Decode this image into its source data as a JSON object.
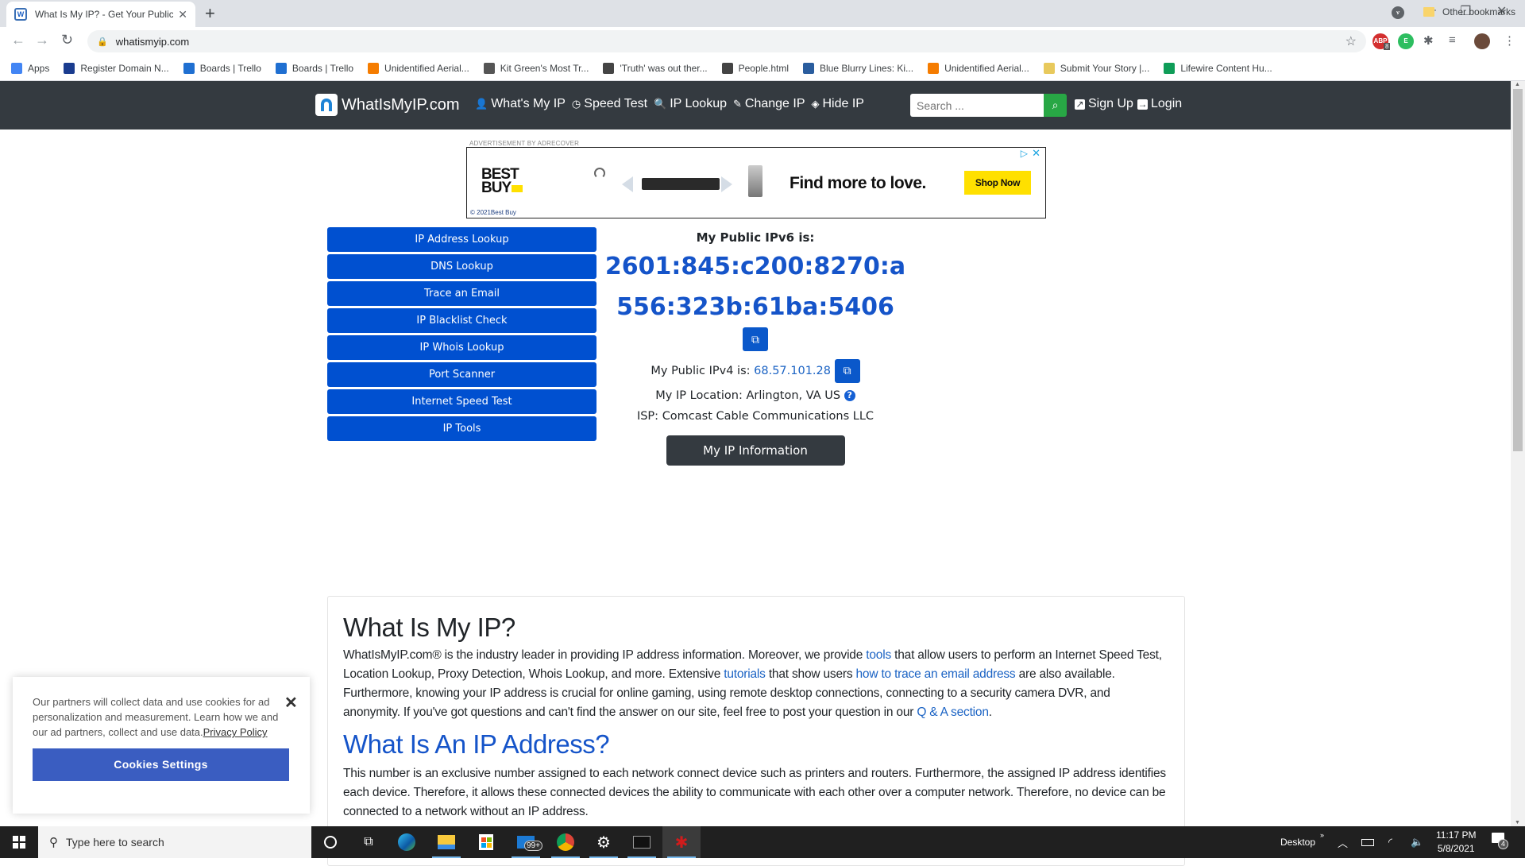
{
  "browser": {
    "tab_title": "What Is My IP? - Get Your Public",
    "url": "whatismyip.com",
    "bookmarks": [
      {
        "label": "Apps",
        "color": "#4285f4"
      },
      {
        "label": "Register Domain N...",
        "color": "#1a3c8f"
      },
      {
        "label": "Boards | Trello",
        "color": "#1f6fd1"
      },
      {
        "label": "Boards | Trello",
        "color": "#1f6fd1"
      },
      {
        "label": "Unidentified Aerial...",
        "color": "#f57c00"
      },
      {
        "label": "Kit Green's Most Tr...",
        "color": "#555555"
      },
      {
        "label": "'Truth' was out ther...",
        "color": "#444444"
      },
      {
        "label": "People.html",
        "color": "#444444"
      },
      {
        "label": "Blue Blurry Lines: Ki...",
        "color": "#2a5d9e"
      },
      {
        "label": "Unidentified Aerial...",
        "color": "#f57c00"
      },
      {
        "label": "Submit Your Story |...",
        "color": "#e8c95c"
      },
      {
        "label": "Lifewire Content Hu...",
        "color": "#0f9d58"
      }
    ],
    "bookmarks_overflow": "»",
    "other_bookmarks": "Other bookmarks",
    "extension_badge": "8"
  },
  "site": {
    "logo_text": "WhatIsMyIP.com",
    "nav": [
      {
        "icon": "user-icon",
        "glyph": "👤",
        "label": "What's My IP"
      },
      {
        "icon": "clock-icon",
        "glyph": "◷",
        "label": "Speed Test"
      },
      {
        "icon": "search-icon",
        "glyph": "🔍",
        "label": "IP Lookup"
      },
      {
        "icon": "edit-icon",
        "glyph": "✎",
        "label": "Change IP"
      },
      {
        "icon": "eye-slash-icon",
        "glyph": "◈",
        "label": "Hide IP"
      }
    ],
    "search_placeholder": "Search ...",
    "signup_label": "Sign Up",
    "login_label": "Login"
  },
  "ad": {
    "label": "ADVERTISEMENT BY ADRECOVER",
    "brand_line1": "BEST",
    "brand_line2": "BUY",
    "tagline": "Find more to love.",
    "cta": "Shop Now",
    "copyright": "© 2021Best Buy"
  },
  "tools": [
    "IP Address Lookup",
    "DNS Lookup",
    "Trace an Email",
    "IP Blacklist Check",
    "IP Whois Lookup",
    "Port Scanner",
    "Internet Speed Test",
    "IP Tools"
  ],
  "ipinfo": {
    "ipv6_label": "My Public IPv6 is:",
    "ipv6_line1": "2601:845:c200:8270:a",
    "ipv6_line2": "556:323b:61ba:5406",
    "ipv4_label": "My Public IPv4 is:",
    "ipv4": "68.57.101.28",
    "location_label": "My IP Location:",
    "location": "Arlington, VA US",
    "isp_label": "ISP:",
    "isp": "Comcast Cable Communications LLC",
    "info_button": "My IP Information"
  },
  "content": {
    "h1": "What Is My IP?",
    "p1": {
      "a": "WhatIsMyIP.com® is the industry leader in providing IP address information. Moreover, we provide ",
      "link1": "tools",
      "b": " that allow users to perform an Internet Speed Test, Location Lookup, Proxy Detection, Whois Lookup, and more. Extensive ",
      "link2": "tutorials",
      "c": " that show users ",
      "link3": "how to trace an email address",
      "d": " are also available. Furthermore, knowing your IP address is crucial for online gaming, using remote desktop connections, connecting to a security camera DVR, and anonymity. If you've got questions and can't find the answer on our site, feel free to post your question in our ",
      "link4": "Q & A section",
      "e": "."
    },
    "h2": "What Is An IP Address?",
    "p2": "This number is an exclusive number assigned to each network connect device such as printers and routers. Furthermore, the assigned IP address identifies each device. Therefore, it allows these connected devices the ability to communicate with each other over a computer network. Therefore, no device can be connected to a network without an IP address."
  },
  "cookie": {
    "message": "Our partners will collect data and use cookies for ad personalization and measurement. Learn how we and our ad partners, collect and use data.",
    "policy_link": "Privacy Policy",
    "settings_button": "Cookies Settings"
  },
  "taskbar": {
    "search_placeholder": "Type here to search",
    "mail_badge": "99+",
    "desktop_label": "Desktop",
    "time": "11:17 PM",
    "date": "5/8/2021",
    "notification_count": "4"
  }
}
